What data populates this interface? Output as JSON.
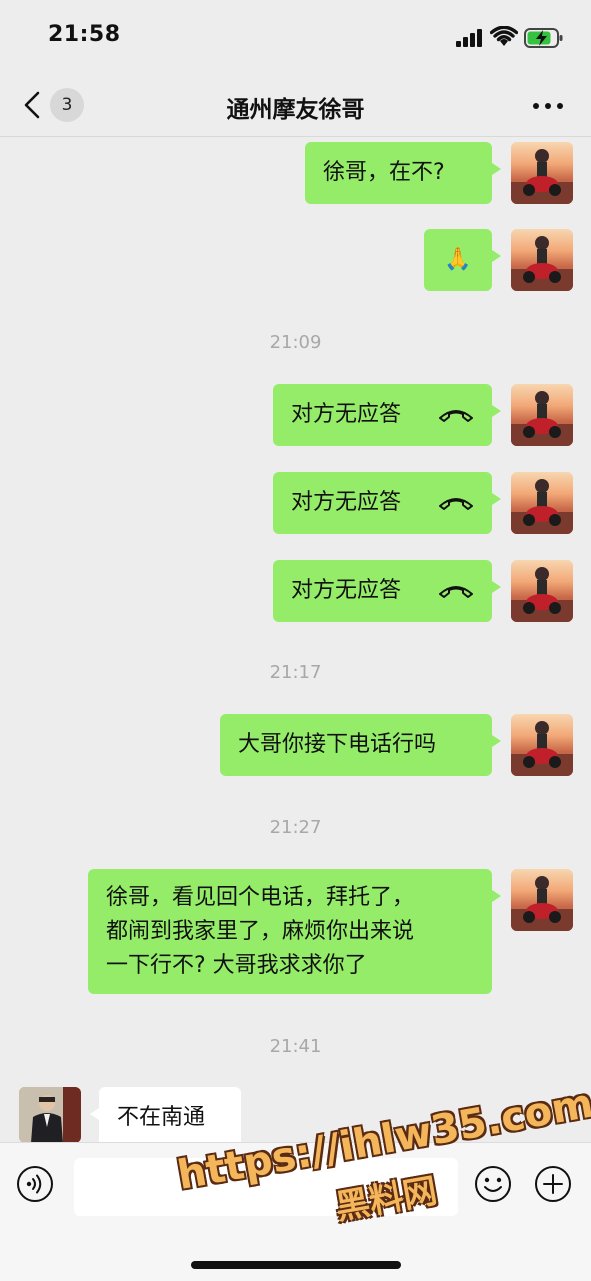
{
  "status_bar": {
    "time": "21:58"
  },
  "nav": {
    "unread_count": "3",
    "title": "通州摩友徐哥"
  },
  "messages": [
    {
      "text": "徐哥，在不?"
    },
    {
      "text": "🙏"
    },
    {
      "timestamp": "21:09"
    },
    {
      "text": "对方无应答"
    },
    {
      "text": "对方无应答"
    },
    {
      "text": "对方无应答"
    },
    {
      "timestamp": "21:17"
    },
    {
      "text": "大哥你接下电话行吗"
    },
    {
      "timestamp": "21:27"
    },
    {
      "lines": [
        "徐哥，看见回个电话，拜托了，",
        "都闹到我家里了，麻烦你出来说",
        "一下行不? 大哥我求求你了"
      ]
    },
    {
      "timestamp": "21:41"
    },
    {
      "text": "不在南通"
    }
  ],
  "watermark": {
    "url": "https://ihlw35.com",
    "name": "黑料网"
  },
  "colors": {
    "sent_bubble": "#95ec69",
    "received_bubble": "#ffffff",
    "background": "#ededed"
  }
}
